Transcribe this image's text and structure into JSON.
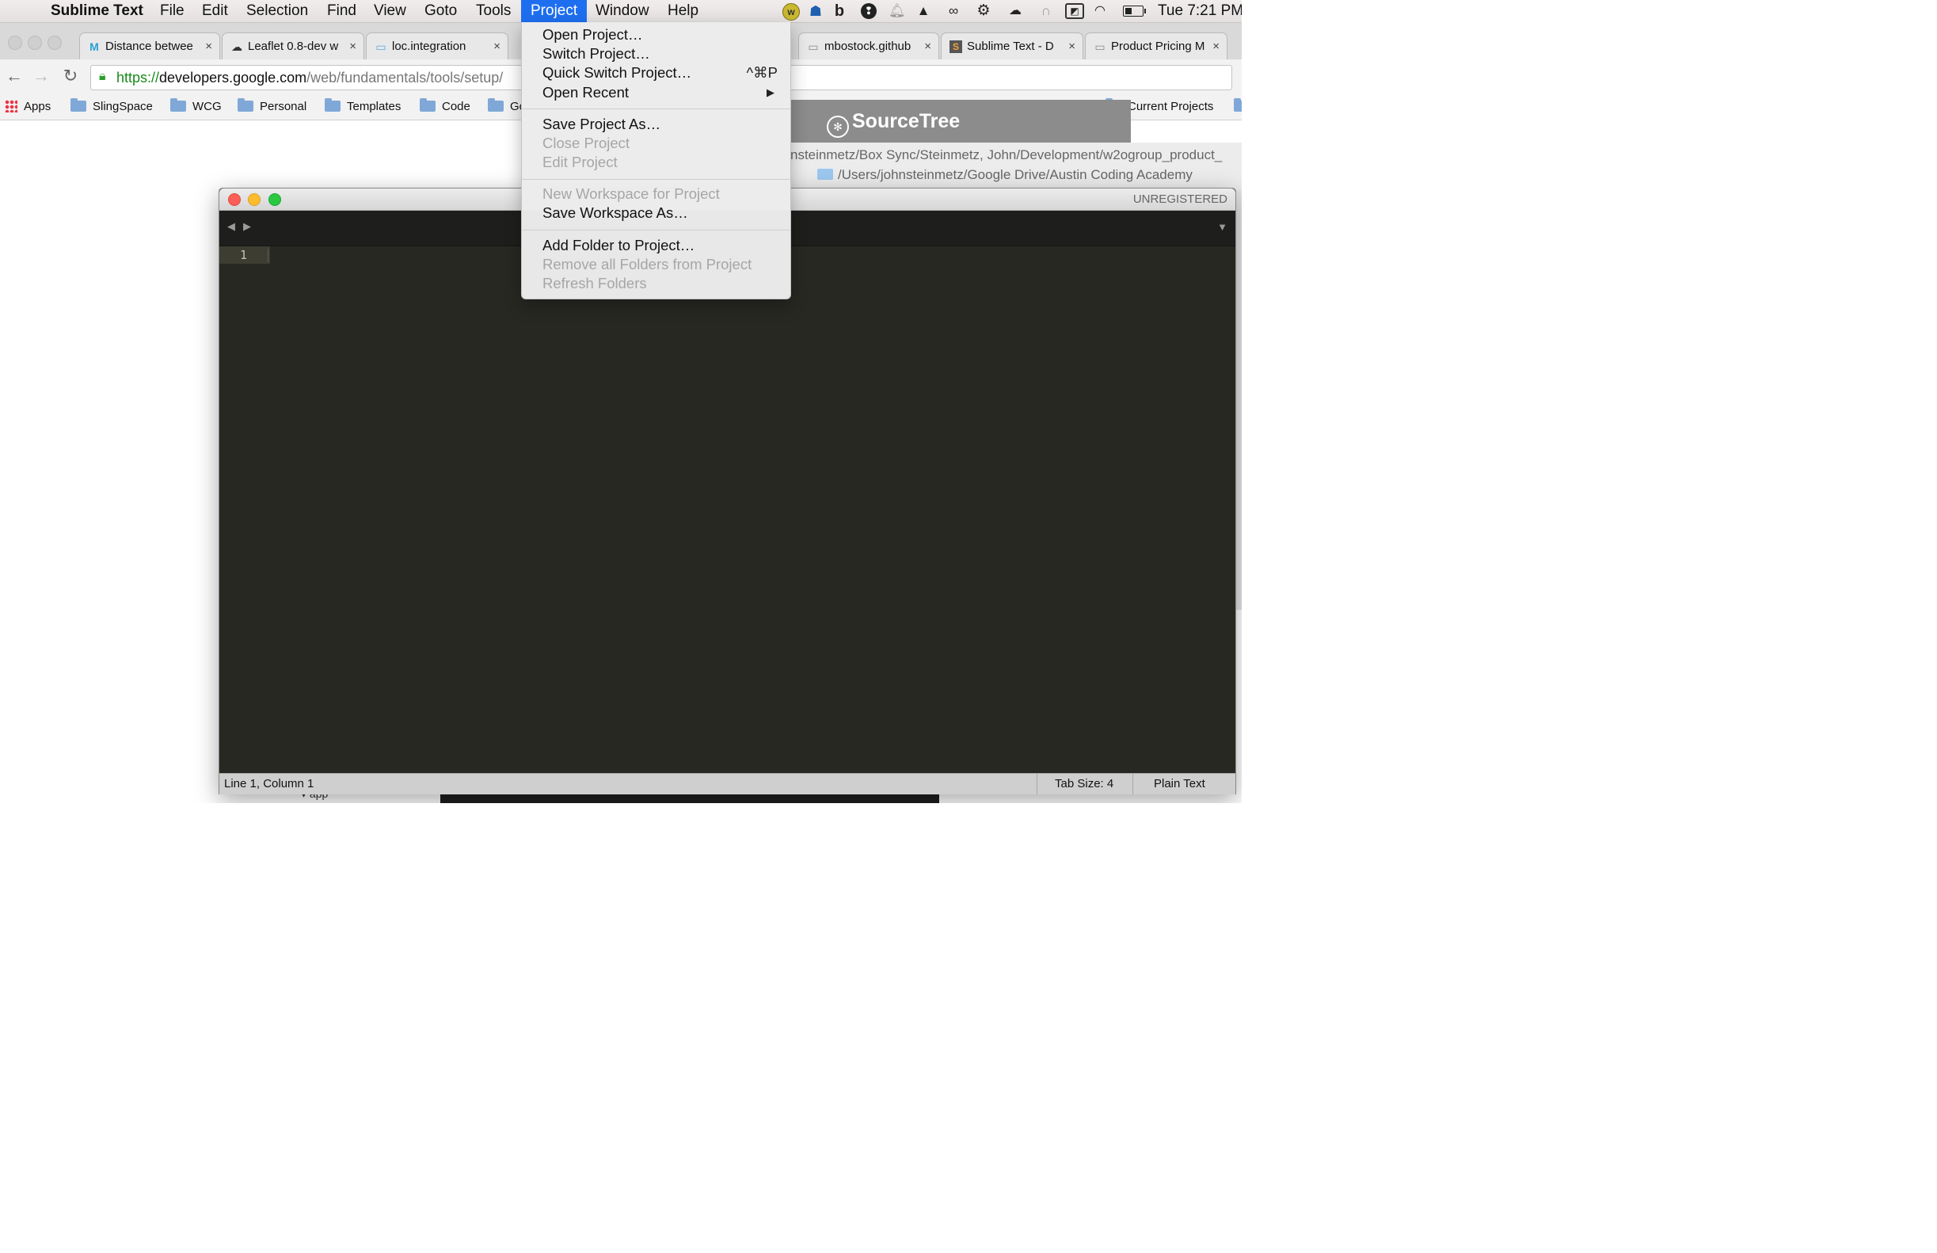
{
  "menubar": {
    "apple": "",
    "app_name": "Sublime Text",
    "items": [
      "File",
      "Edit",
      "Selection",
      "Find",
      "View",
      "Goto",
      "Tools",
      "Project",
      "Window",
      "Help"
    ],
    "active_item": "Project",
    "clock": "Tue 7:21 PM",
    "tray_icons": [
      "wunderlist-icon",
      "evernote-icon",
      "b-icon",
      "hipchat-icon",
      "notification-bell-icon",
      "google-drive-icon",
      "creative-cloud-icon",
      "settings-gear-icon",
      "cloud-hat-icon",
      "headphones-icon",
      "bookmark-icon",
      "wifi-icon",
      "battery-icon"
    ]
  },
  "browser": {
    "tabs": [
      {
        "icon": "M",
        "title": "Distance betwee",
        "close": "×"
      },
      {
        "icon": "☁",
        "title": "Leaflet 0.8-dev w",
        "close": "×"
      },
      {
        "icon": "▭",
        "title": "loc.integration",
        "close": "×"
      },
      {
        "icon": "▭",
        "title": "mbostock.github",
        "close": "×"
      },
      {
        "icon": "S",
        "title": "Sublime Text - D",
        "close": "×"
      },
      {
        "icon": "▭",
        "title": "Product Pricing M",
        "close": "×"
      }
    ],
    "url": {
      "scheme": "https://",
      "host": "developers.google.com",
      "path": "/web/fundamentals/tools/setup/"
    },
    "bookmarks": [
      {
        "label": "Apps",
        "type": "apps"
      },
      {
        "label": "SlingSpace",
        "type": "folder"
      },
      {
        "label": "WCG",
        "type": "folder"
      },
      {
        "label": "Personal",
        "type": "folder"
      },
      {
        "label": "Templates",
        "type": "folder"
      },
      {
        "label": "Code",
        "type": "folder"
      },
      {
        "label": "Go",
        "type": "folder"
      },
      {
        "label": "Current Projects",
        "type": "folder"
      }
    ]
  },
  "sourcetree": {
    "logo": "SourceTree",
    "paths": [
      "nsteinmetz/Box Sync/Steinmetz, John/Development/w2ogroup_product_",
      "/Users/johnsteinmetz/Google Drive/Austin Coding Academy"
    ]
  },
  "sublime": {
    "unregistered": "UNREGISTERED",
    "nav_back": "◀",
    "nav_forward": "▶",
    "tab_dropdown": "▼",
    "line_number": "1",
    "status": {
      "position": "Line 1, Column 1",
      "tab_size": "Tab Size: 4",
      "syntax": "Plain Text"
    },
    "background_label": "app"
  },
  "project_menu": {
    "groups": [
      [
        {
          "label": "Open Project…",
          "enabled": true
        },
        {
          "label": "Switch Project…",
          "enabled": true
        },
        {
          "label": "Quick Switch Project…",
          "enabled": true,
          "shortcut": "^⌘P"
        },
        {
          "label": "Open Recent",
          "enabled": true,
          "submenu": "▶"
        }
      ],
      [
        {
          "label": "Save Project As…",
          "enabled": true
        },
        {
          "label": "Close Project",
          "enabled": false
        },
        {
          "label": "Edit Project",
          "enabled": false
        }
      ],
      [
        {
          "label": "New Workspace for Project",
          "enabled": false
        },
        {
          "label": "Save Workspace As…",
          "enabled": true
        }
      ],
      [
        {
          "label": "Add Folder to Project…",
          "enabled": true
        },
        {
          "label": "Remove all Folders from Project",
          "enabled": false
        },
        {
          "label": "Refresh Folders",
          "enabled": false
        }
      ]
    ]
  }
}
